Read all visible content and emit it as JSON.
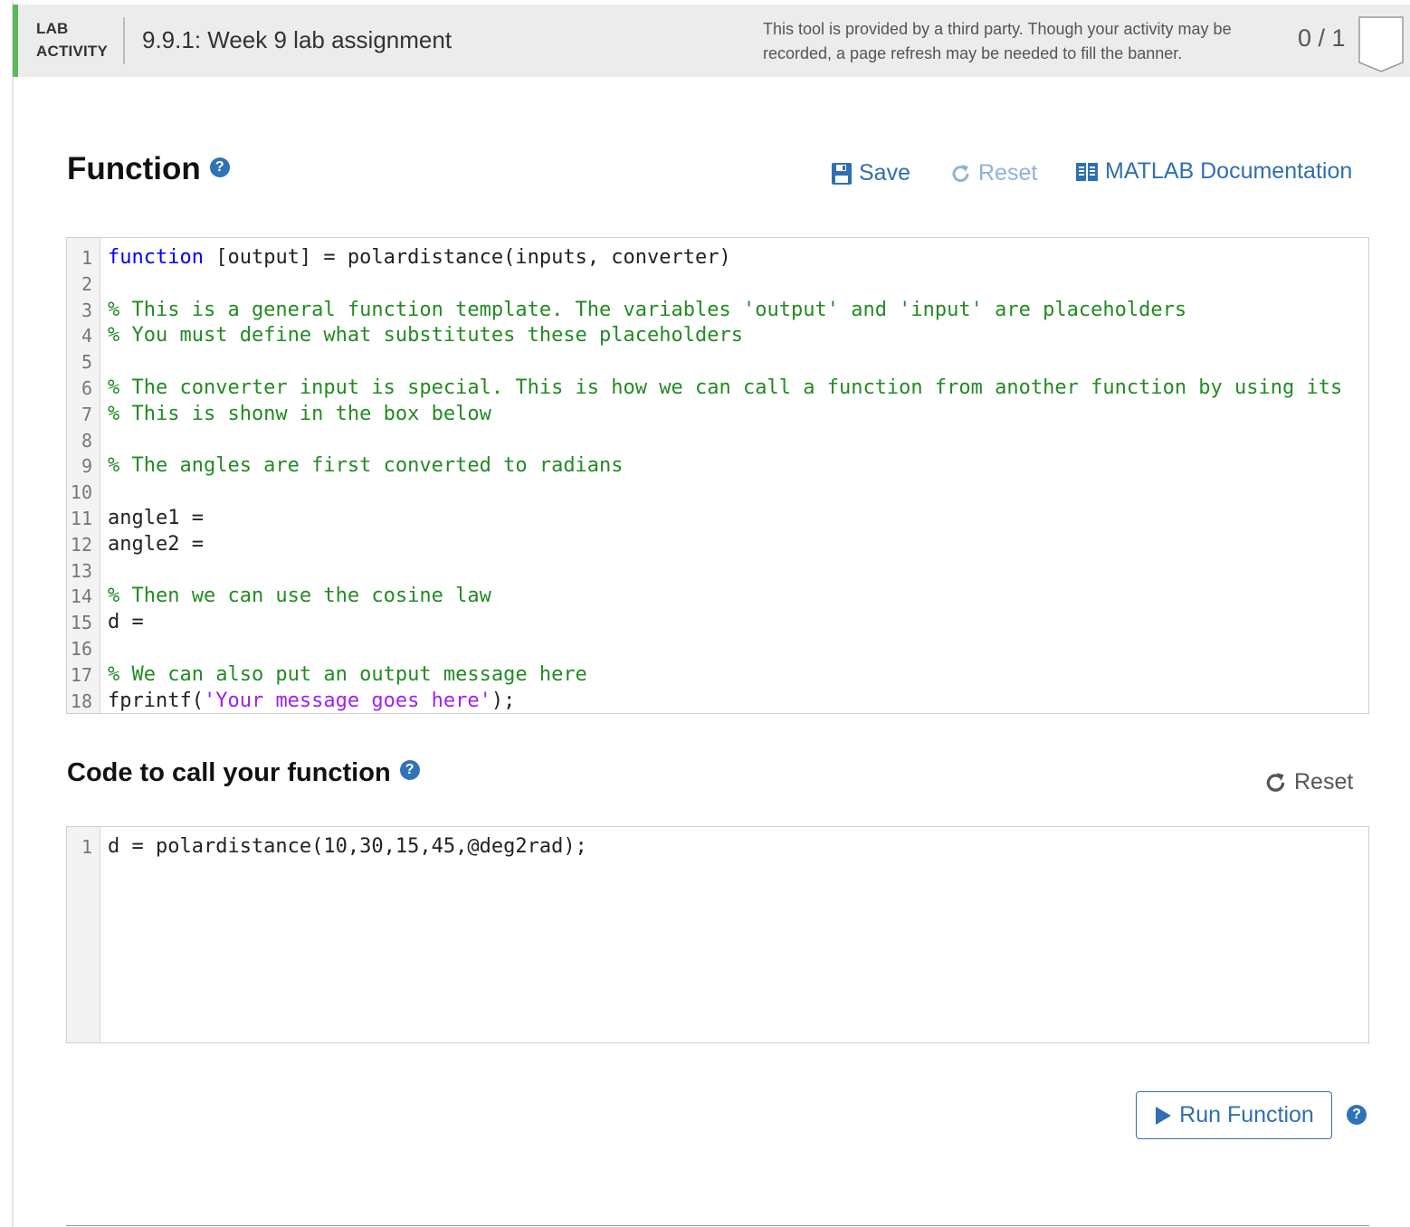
{
  "header": {
    "tag_line1": "LAB",
    "tag_line2": "ACTIVITY",
    "title": "9.9.1: Week 9 lab assignment",
    "notice": "This tool is provided by a third party. Though your activity may be recorded, a page refresh may be needed to fill the banner.",
    "score": "0 / 1"
  },
  "function_section": {
    "title": "Function",
    "help_glyph": "?",
    "save_label": "Save",
    "reset_label": "Reset",
    "docs_label": "MATLAB Documentation"
  },
  "function_code": [
    [
      {
        "t": "function",
        "c": "kw"
      },
      {
        "t": " [output] = polardistance(inputs, converter)",
        "c": ""
      }
    ],
    [],
    [
      {
        "t": "% This is a general function template. The variables 'output' and 'input' are placeholders",
        "c": "cm"
      }
    ],
    [
      {
        "t": "% You must define what substitutes these placeholders",
        "c": "cm"
      }
    ],
    [],
    [
      {
        "t": "% The converter input is special. This is how we can call a function from another function by using its",
        "c": "cm"
      }
    ],
    [
      {
        "t": "% This is shonw in the box below",
        "c": "cm"
      }
    ],
    [],
    [
      {
        "t": "% The angles are first converted to radians",
        "c": "cm"
      }
    ],
    [],
    [
      {
        "t": "angle1 =",
        "c": ""
      }
    ],
    [
      {
        "t": "angle2 =",
        "c": ""
      }
    ],
    [],
    [
      {
        "t": "% Then we can use the cosine law",
        "c": "cm"
      }
    ],
    [
      {
        "t": "d =",
        "c": ""
      }
    ],
    [],
    [
      {
        "t": "% We can also put an output message here",
        "c": "cm"
      }
    ],
    [
      {
        "t": "fprintf(",
        "c": ""
      },
      {
        "t": "'Your message goes here'",
        "c": "str"
      },
      {
        "t": ");",
        "c": ""
      }
    ]
  ],
  "call_section": {
    "title": "Code to call your function",
    "help_glyph": "?",
    "reset_label": "Reset"
  },
  "call_code": [
    [
      {
        "t": "d = polardistance(10,30,15,45,@deg2rad);",
        "c": ""
      }
    ]
  ],
  "run": {
    "label": "Run Function",
    "help_glyph": "?"
  },
  "colors": {
    "accent_green": "#5cb85c",
    "link_blue": "#2f6fb3",
    "keyword": "#0000ff",
    "comment": "#228b22",
    "string": "#a020f0"
  }
}
